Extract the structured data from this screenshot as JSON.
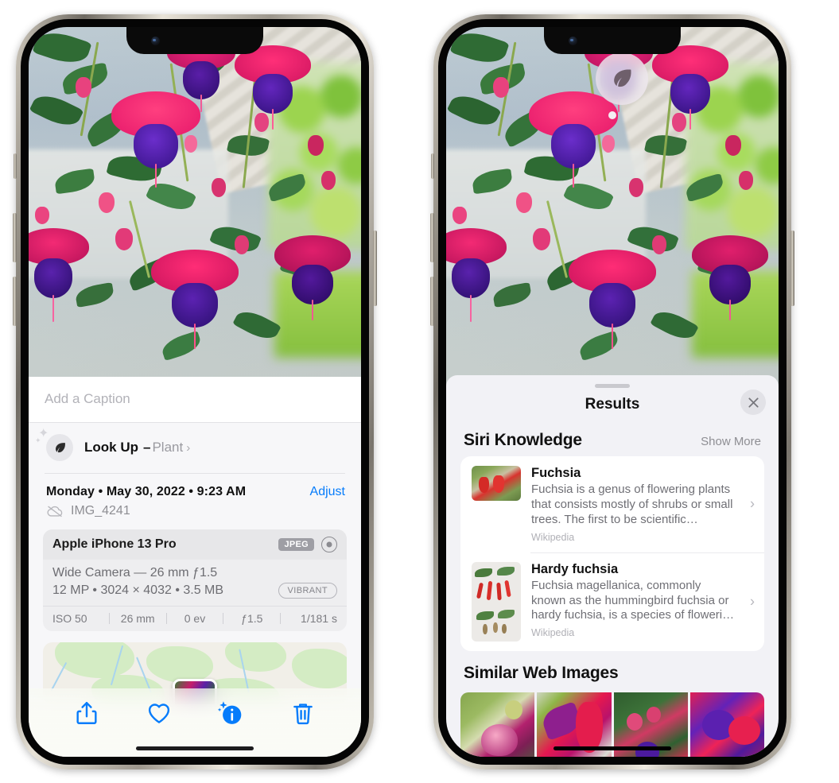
{
  "left_phone": {
    "name": "Photos app — photo info view",
    "caption_field": {
      "placeholder": "Add a Caption",
      "value": ""
    },
    "look_up": {
      "label": "Look Up",
      "separator": "–",
      "value": "Plant",
      "icon": "leaf-icon",
      "chevron": "›"
    },
    "metadata": {
      "datetime": "Monday • May 30, 2022 • 9:23 AM",
      "adjust_label": "Adjust",
      "filename": "IMG_4241",
      "cloud_icon": "cloud-slash-icon"
    },
    "camera_card": {
      "model": "Apple iPhone 13 Pro",
      "format_badge": "JPEG",
      "aperture_icon": "aperture-icon",
      "lens_line": "Wide Camera — 26 mm ƒ1.5",
      "size_line": "12 MP • 3024 × 4032 • 3.5 MB",
      "style_badge": "VIBRANT",
      "exif": [
        "ISO 50",
        "26 mm",
        "0 ev",
        "ƒ1.5",
        "1/181 s"
      ]
    },
    "toolbar": {
      "share_label": "share-icon",
      "favorite_label": "heart-icon",
      "info_label": "info-sparkle-icon",
      "delete_label": "trash-icon"
    },
    "accent_color": "#067CFB"
  },
  "right_phone": {
    "name": "Visual Look Up results sheet",
    "badge": {
      "icon": "leaf-icon",
      "label": "visual-look-up-badge"
    },
    "sheet": {
      "title": "Results",
      "close_icon": "close-icon"
    },
    "siri_knowledge": {
      "title": "Siri Knowledge",
      "show_more": "Show More",
      "items": [
        {
          "title": "Fuchsia",
          "description": "Fuchsia is a genus of flowering plants that consists mostly of shrubs or small trees. The first to be scientific…",
          "source": "Wikipedia",
          "chevron": "›"
        },
        {
          "title": "Hardy fuchsia",
          "description": "Fuchsia magellanica, commonly known as the hummingbird fuchsia or hardy fuchsia, is a species of floweri…",
          "source": "Wikipedia",
          "chevron": "›"
        }
      ]
    },
    "similar_web_images": {
      "title": "Similar Web Images",
      "count": 4
    }
  }
}
